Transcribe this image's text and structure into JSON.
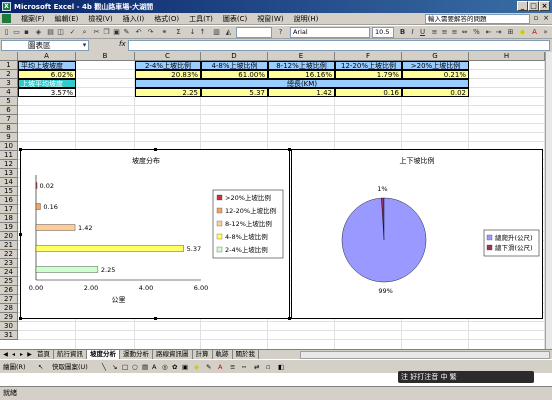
{
  "window": {
    "title": "Microsoft Excel - 4b 觀山路車場-大湖間",
    "min_label": "_",
    "max_label": "□",
    "close_label": "×"
  },
  "menu": {
    "items": [
      "檔案(F)",
      "編輯(E)",
      "檢視(V)",
      "插入(I)",
      "格式(O)",
      "工具(T)",
      "圖表(C)",
      "視窗(W)",
      "說明(H)"
    ],
    "help_placeholder": "輸入需要解答的問題"
  },
  "toolbar": {
    "font_name": "Arial",
    "font_size": "10.5"
  },
  "formula_bar": {
    "name_box": "圖表區",
    "fx": "fx",
    "value": ""
  },
  "grid": {
    "columns": [
      "A",
      "B",
      "C",
      "D",
      "E",
      "F",
      "G",
      "H"
    ],
    "rows": [
      "1",
      "2",
      "3",
      "4",
      "5",
      "6",
      "7",
      "8",
      "9",
      "10",
      "11",
      "12",
      "13",
      "14",
      "15",
      "16",
      "17",
      "18",
      "19",
      "20",
      "21",
      "22",
      "23",
      "24",
      "25",
      "26",
      "27",
      "28",
      "29",
      "30",
      "31"
    ],
    "a1": "平均上坡坡度",
    "a2": "6.02%",
    "a3": "上坡平均坡度",
    "a4": "3.57%",
    "c1": "2-4%上坡比例",
    "d1": "4-8%上坡比例",
    "e1": "8-12%上坡比例",
    "f1": "12-20%上坡比例",
    "g1": ">20%上坡比例",
    "c2": "20.83%",
    "d2": "61.00%",
    "e2": "16.16%",
    "f2": "1.79%",
    "g2": "0.21%",
    "e3": "總長(KM)",
    "c4": "2.25",
    "d4": "5.37",
    "e4": "1.42",
    "f4": "0.16",
    "g4": "0.02"
  },
  "colors": {
    "header_blue": "#99ccff",
    "yellow": "#ffff99",
    "cyan": "#33cccc",
    "bar_gt20": "#cc3333",
    "bar_12_20": "#f4a460",
    "bar_8_12": "#ffcc99",
    "bar_4_8": "#ffff66",
    "bar_2_4": "#ccffcc",
    "pie_up": "#9999ff",
    "pie_down": "#993366"
  },
  "chart_data": [
    {
      "type": "bar",
      "title": "坡度分布",
      "xlabel": "公里",
      "ylabel": "",
      "xlim": [
        0,
        6
      ],
      "x_ticks": [
        "0.00",
        "2.00",
        "4.00",
        "6.00"
      ],
      "categories": [
        "2-4%上坡比例",
        "4-8%上坡比例",
        "8-12%上坡比例",
        "12-20%上坡比例",
        ">20%上坡比例"
      ],
      "values": [
        2.25,
        5.37,
        1.42,
        0.16,
        0.02
      ],
      "value_labels": [
        "2.25",
        "5.37",
        "1.42",
        "0.16",
        "0.02"
      ],
      "legend": [
        ">20%上坡比例",
        "12-20%上坡比例",
        "8-12%上坡比例",
        "4-8%上坡比例",
        "2-4%上坡比例"
      ],
      "legend_position": "right"
    },
    {
      "type": "pie",
      "title": "上下坡比例",
      "categories": [
        "總爬升(公尺)",
        "總下滑(公尺)"
      ],
      "values": [
        99,
        1
      ],
      "value_labels": [
        "99%",
        "1%"
      ],
      "legend": [
        "總爬升(公尺)",
        "總下滑(公尺)"
      ],
      "legend_position": "right"
    }
  ],
  "sheet_tabs": {
    "items": [
      "首頁",
      "航行資訊",
      "坡度分析",
      "運動分析",
      "路線資訊圖",
      "計算",
      "軌跡",
      "關於我"
    ],
    "active_index": 2
  },
  "drawing_toolbar": {
    "draw_label": "繪圖(R)",
    "autoshape_label": "快取圖案(U)"
  },
  "ime": {
    "text": "注 好打注音 中 繁"
  },
  "status": {
    "text": "就緒"
  }
}
